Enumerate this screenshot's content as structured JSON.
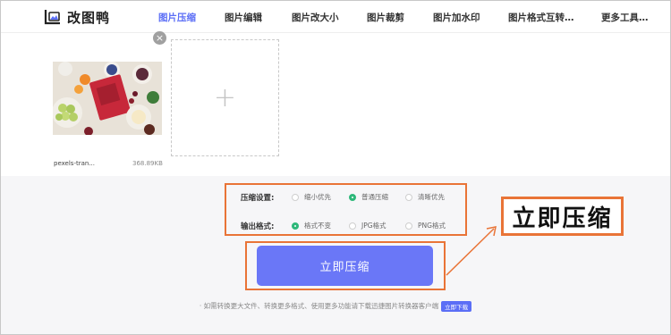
{
  "header": {
    "logo_text": "改图鸭",
    "nav": [
      {
        "label": "图片压缩",
        "active": true
      },
      {
        "label": "图片编辑",
        "active": false
      },
      {
        "label": "图片改大小",
        "active": false
      },
      {
        "label": "图片裁剪",
        "active": false
      },
      {
        "label": "图片加水印",
        "active": false
      },
      {
        "label": "图片格式互转…",
        "active": false
      },
      {
        "label": "更多工具…",
        "active": false
      }
    ]
  },
  "upload": {
    "file_name": "pexels-tran...",
    "file_size": "368.89KB",
    "close_glyph": "×",
    "add_glyph": "+"
  },
  "settings": {
    "compress_label": "压缩设置:",
    "compress_options": [
      {
        "label": "缩小优先",
        "selected": false
      },
      {
        "label": "普通压缩",
        "selected": true
      },
      {
        "label": "清晰优先",
        "selected": false
      }
    ],
    "format_label": "输出格式:",
    "format_options": [
      {
        "label": "格式不变",
        "selected": true
      },
      {
        "label": "JPG格式",
        "selected": false
      },
      {
        "label": "PNG格式",
        "selected": false
      }
    ]
  },
  "compress_button": "立即压缩",
  "callout": "立即压缩",
  "footer": {
    "text": "· 如需转换更大文件、转换更多格式、使用更多功能请下载迅捷图片转换器客户端",
    "link": "立即下载"
  },
  "colors": {
    "accent": "#6a77f7",
    "active_nav": "#5b6ef6",
    "highlight": "#e97437",
    "radio_on": "#2eb87a"
  }
}
